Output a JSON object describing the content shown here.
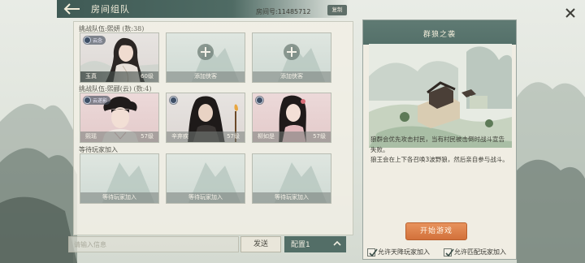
{
  "header": {
    "title": "房间组队",
    "room_id": "房间号:11485712",
    "copy_label": "复制"
  },
  "team1": {
    "label": "挑战队伍:熙妍",
    "count": "(数:38)",
    "slots": [
      {
        "type": "hero",
        "name": "玉真",
        "level": "60级",
        "badge": "云念"
      },
      {
        "type": "empty",
        "label": "添加侠客"
      },
      {
        "type": "empty",
        "label": "添加侠客"
      }
    ]
  },
  "team2": {
    "label": "挑战队伍:熙郦(云)",
    "count": "(数:4)",
    "slots": [
      {
        "type": "hero",
        "name": "熙瑶",
        "level": "57级",
        "badge": "云遂影"
      },
      {
        "type": "hero",
        "name": "辛弃疾",
        "level": "57级"
      },
      {
        "type": "hero",
        "name": "柳如是",
        "level": "57级"
      }
    ]
  },
  "waiting": {
    "label": "等待玩家加入",
    "slots": [
      "等待玩家加入",
      "等待玩家加入",
      "等待玩家加入"
    ]
  },
  "chat": {
    "placeholder": "请输入信息",
    "send_label": "发送",
    "config_value": "配置1"
  },
  "mission": {
    "title": "群狼之袭",
    "desc_1": "狼群会优先攻击村民，当有村民被击倒时战斗宣告失败。",
    "desc_2": "狼王会在上下各召唤3波野狼，然后亲自参与战斗。",
    "start_label": "开始游戏"
  },
  "options": {
    "allow_tianjiang": "允许天降玩家加入",
    "allow_match": "允许匹配玩家加入"
  },
  "colors": {
    "accent": "#547069",
    "start_button": "#d2713b",
    "panel": "#f0ede3"
  }
}
